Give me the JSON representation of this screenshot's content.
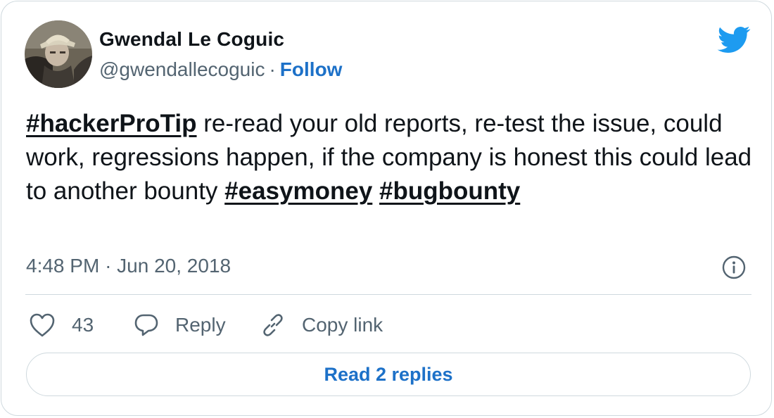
{
  "author": {
    "display_name": "Gwendal Le Coguic",
    "handle": "@gwendallecoguic",
    "separator": "·",
    "follow_label": "Follow",
    "avatar_icon": "profile-photo"
  },
  "brand": {
    "icon": "twitter-bird-icon",
    "color": "#1d9bf0"
  },
  "tweet": {
    "hashtag_1": "#hackerProTip",
    "text_1": " re-read your old reports, re-test the issue, could work, regressions happen, if the company is honest this could lead to another bounty ",
    "hashtag_2": "#easymoney",
    "text_2": " ",
    "hashtag_3": "#bugbounty"
  },
  "meta": {
    "time": "4:48 PM",
    "separator": "·",
    "date": "Jun 20, 2018",
    "info_icon": "info-icon"
  },
  "actions": {
    "like_count": "43",
    "reply_label": "Reply",
    "copy_link_label": "Copy link"
  },
  "replies_button": {
    "label": "Read 2 replies"
  },
  "colors": {
    "link": "#1d71c8",
    "secondary_text": "#536471",
    "border": "#cfd9de",
    "text": "#0f1419"
  }
}
